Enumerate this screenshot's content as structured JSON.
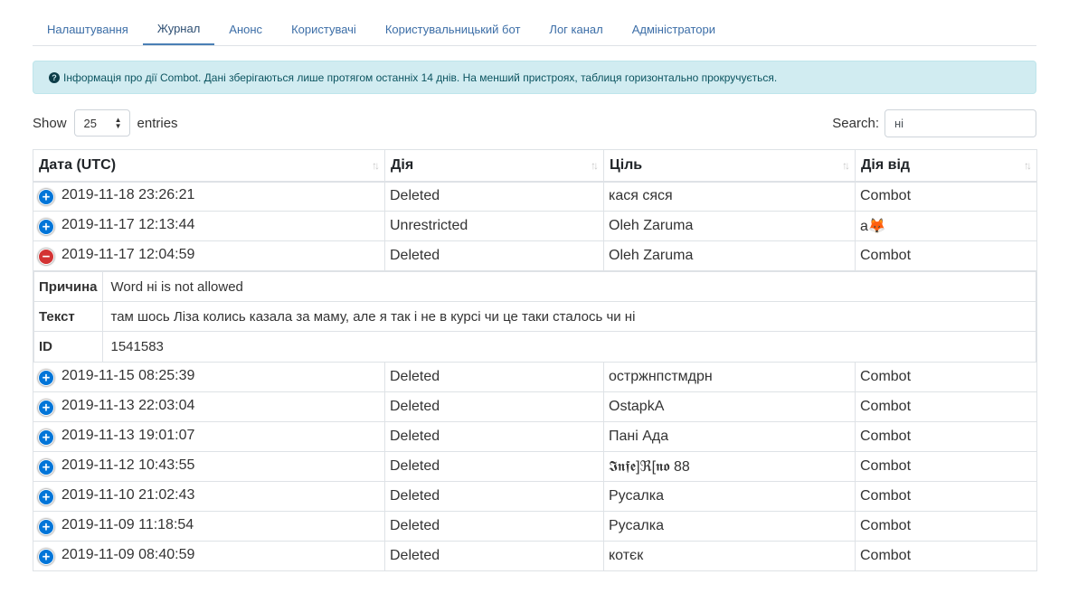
{
  "tabs": [
    {
      "label": "Налаштування",
      "active": false
    },
    {
      "label": "Журнал",
      "active": true
    },
    {
      "label": "Анонс",
      "active": false
    },
    {
      "label": "Користувачі",
      "active": false
    },
    {
      "label": "Користувальницький бот",
      "active": false
    },
    {
      "label": "Лог канал",
      "active": false
    },
    {
      "label": "Адміністратори",
      "active": false
    }
  ],
  "alert": {
    "icon": "question-circle-icon",
    "text": "Інформація про дії Combot. Дані зберігаються лише протягом останніх 14 днів. На менший пристроях, таблиця горизонтально прокручується."
  },
  "controls": {
    "show_label": "Show",
    "entries_value": "25",
    "entries_label": "entries",
    "search_label": "Search:",
    "search_value": "ні"
  },
  "table": {
    "columns": [
      "Дата (UTC)",
      "Дія",
      "Ціль",
      "Дія від"
    ],
    "rows": [
      {
        "date": "2019-11-18 23:26:21",
        "action": "Deleted",
        "target": "кася сяся",
        "by": "Combot",
        "expanded": false
      },
      {
        "date": "2019-11-17 12:13:44",
        "action": "Unrestricted",
        "target": "Oleh Zaruma",
        "by": "a🦊",
        "expanded": false
      },
      {
        "date": "2019-11-17 12:04:59",
        "action": "Deleted",
        "target": "Oleh Zaruma",
        "by": "Combot",
        "expanded": true
      },
      {
        "date": "2019-11-15 08:25:39",
        "action": "Deleted",
        "target": "остржнпстмдрн",
        "by": "Combot",
        "expanded": false
      },
      {
        "date": "2019-11-13 22:03:04",
        "action": "Deleted",
        "target": "OstapkA",
        "by": "Combot",
        "expanded": false
      },
      {
        "date": "2019-11-13 19:01:07",
        "action": "Deleted",
        "target": "Пані Ада",
        "by": "Combot",
        "expanded": false
      },
      {
        "date": "2019-11-12 10:43:55",
        "action": "Deleted",
        "target": "𝕴𝖓𝖋𝖊]ℜ[𝖓𝖔 88",
        "by": "Combot",
        "expanded": false
      },
      {
        "date": "2019-11-10 21:02:43",
        "action": "Deleted",
        "target": "Русалка",
        "by": "Combot",
        "expanded": false
      },
      {
        "date": "2019-11-09 11:18:54",
        "action": "Deleted",
        "target": "Русалка",
        "by": "Combot",
        "expanded": false
      },
      {
        "date": "2019-11-09 08:40:59",
        "action": "Deleted",
        "target": "котєк",
        "by": "Combot",
        "expanded": false
      }
    ],
    "detail": {
      "reason_label": "Причина",
      "reason_value": "Word ні is not allowed",
      "text_label": "Текст",
      "text_value": "там шось Ліза колись казала за маму, але я так і не в курсі чи це таки сталось чи ні",
      "id_label": "ID",
      "id_value": "1541583"
    }
  },
  "colors": {
    "link": "#3c6ea7",
    "alert_bg": "#d1ecf1",
    "expand_button": "#0275d8",
    "collapse_button": "#d33333"
  }
}
